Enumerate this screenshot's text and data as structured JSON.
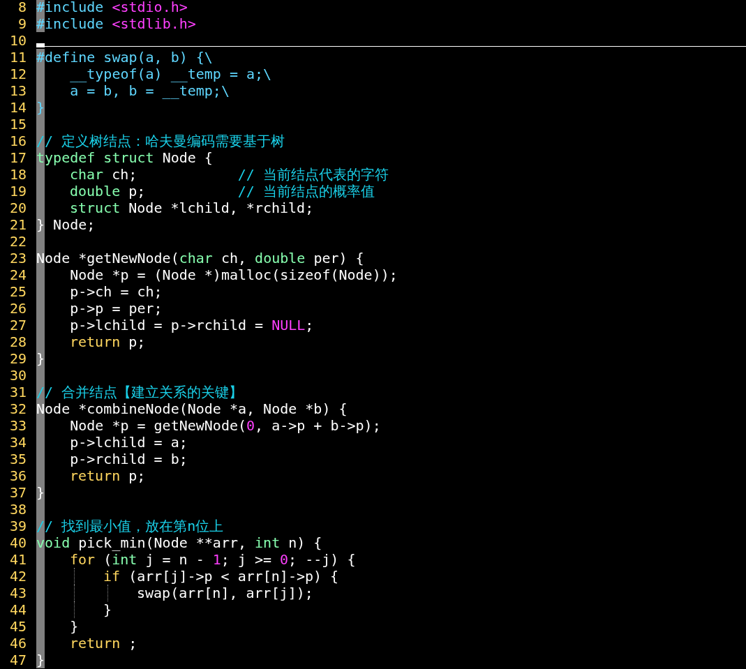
{
  "editor": {
    "lines": [
      {
        "number": "8",
        "current": false,
        "tokens": [
          {
            "text": "#include",
            "kind": "preproc"
          },
          {
            "text": " <stdio.h>",
            "kind": "string"
          }
        ]
      },
      {
        "number": "9",
        "current": false,
        "tokens": [
          {
            "text": "#include",
            "kind": "preproc"
          },
          {
            "text": " <stdlib.h>",
            "kind": "string"
          }
        ]
      },
      {
        "number": "10",
        "current": true
      },
      {
        "number": "11",
        "current": false,
        "tokens": [
          {
            "text": "#define swap(a, b) {\\",
            "kind": "preproc"
          }
        ]
      },
      {
        "number": "12",
        "current": false,
        "tokens": [
          {
            "text": "    __typeof(a) __temp = a;\\",
            "kind": "preproc"
          }
        ]
      },
      {
        "number": "13",
        "current": false,
        "tokens": [
          {
            "text": "    a = b, b = __temp;\\",
            "kind": "preproc"
          }
        ]
      },
      {
        "number": "14",
        "current": false,
        "tokens": [
          {
            "text": "}",
            "kind": "preproc"
          }
        ]
      },
      {
        "number": "15",
        "current": false
      },
      {
        "number": "16",
        "current": false,
        "tokens": [
          {
            "text": "// 定义树结点：哈夫曼编码需要基于树",
            "kind": "comment"
          }
        ]
      },
      {
        "number": "17",
        "current": false,
        "tokens": [
          {
            "text": "typedef struct",
            "kind": "type"
          },
          {
            "text": " Node {",
            "kind": "plain"
          }
        ]
      },
      {
        "number": "18",
        "current": false,
        "tokens": [
          {
            "kind": "indent"
          },
          {
            "text": "char",
            "kind": "type"
          },
          {
            "text": " ch;            ",
            "kind": "plain"
          },
          {
            "text": "// 当前结点代表的字符",
            "kind": "comment"
          }
        ]
      },
      {
        "number": "19",
        "current": false,
        "tokens": [
          {
            "kind": "indent"
          },
          {
            "text": "double",
            "kind": "type"
          },
          {
            "text": " p;           ",
            "kind": "plain"
          },
          {
            "text": "// 当前结点的概率值",
            "kind": "comment"
          }
        ]
      },
      {
        "number": "20",
        "current": false,
        "tokens": [
          {
            "kind": "indent"
          },
          {
            "text": "struct",
            "kind": "type"
          },
          {
            "text": " Node *lchild, *rchild;",
            "kind": "plain"
          }
        ]
      },
      {
        "number": "21",
        "current": false,
        "tokens": [
          {
            "text": "} Node;",
            "kind": "plain"
          }
        ]
      },
      {
        "number": "22",
        "current": false
      },
      {
        "number": "23",
        "current": false,
        "tokens": [
          {
            "text": "Node *getNewNode(",
            "kind": "plain"
          },
          {
            "text": "char",
            "kind": "type"
          },
          {
            "text": " ch, ",
            "kind": "plain"
          },
          {
            "text": "double",
            "kind": "type"
          },
          {
            "text": " per) {",
            "kind": "plain"
          }
        ]
      },
      {
        "number": "24",
        "current": false,
        "tokens": [
          {
            "text": "    Node *p = (Node *)malloc(sizeof(Node));",
            "kind": "plain"
          }
        ]
      },
      {
        "number": "25",
        "current": false,
        "tokens": [
          {
            "text": "    p->ch = ch;",
            "kind": "plain"
          }
        ]
      },
      {
        "number": "26",
        "current": false,
        "tokens": [
          {
            "text": "    p->p = per;",
            "kind": "plain"
          }
        ]
      },
      {
        "number": "27",
        "current": false,
        "tokens": [
          {
            "text": "    p->lchild = p->rchild = ",
            "kind": "plain"
          },
          {
            "text": "NULL",
            "kind": "constant"
          },
          {
            "text": ";",
            "kind": "plain"
          }
        ]
      },
      {
        "number": "28",
        "current": false,
        "tokens": [
          {
            "kind": "indent"
          },
          {
            "text": "return",
            "kind": "keyword"
          },
          {
            "text": " p;",
            "kind": "plain"
          }
        ]
      },
      {
        "number": "29",
        "current": false,
        "tokens": [
          {
            "text": "}",
            "kind": "plain"
          }
        ]
      },
      {
        "number": "30",
        "current": false
      },
      {
        "number": "31",
        "current": false,
        "tokens": [
          {
            "text": "// 合并结点【建立关系的关键】",
            "kind": "comment"
          }
        ]
      },
      {
        "number": "32",
        "current": false,
        "tokens": [
          {
            "text": "Node *combineNode(Node *a, Node *b) {",
            "kind": "plain"
          }
        ]
      },
      {
        "number": "33",
        "current": false,
        "tokens": [
          {
            "text": "    Node *p = getNewNode(",
            "kind": "plain"
          },
          {
            "text": "0",
            "kind": "constant"
          },
          {
            "text": ", a->p + b->p);",
            "kind": "plain"
          }
        ]
      },
      {
        "number": "34",
        "current": false,
        "tokens": [
          {
            "text": "    p->lchild = a;",
            "kind": "plain"
          }
        ]
      },
      {
        "number": "35",
        "current": false,
        "tokens": [
          {
            "text": "    p->rchild = b;",
            "kind": "plain"
          }
        ]
      },
      {
        "number": "36",
        "current": false,
        "tokens": [
          {
            "kind": "indent"
          },
          {
            "text": "return",
            "kind": "keyword"
          },
          {
            "text": " p;",
            "kind": "plain"
          }
        ]
      },
      {
        "number": "37",
        "current": false,
        "tokens": [
          {
            "text": "}",
            "kind": "plain"
          }
        ]
      },
      {
        "number": "38",
        "current": false
      },
      {
        "number": "39",
        "current": false,
        "tokens": [
          {
            "text": "// 找到最小值，放在第n位上",
            "kind": "comment"
          }
        ]
      },
      {
        "number": "40",
        "current": false,
        "tokens": [
          {
            "text": "void",
            "kind": "type"
          },
          {
            "text": " pick_min(Node **arr, ",
            "kind": "plain"
          },
          {
            "text": "int",
            "kind": "type"
          },
          {
            "text": " n) {",
            "kind": "plain"
          }
        ]
      },
      {
        "number": "41",
        "current": false,
        "tokens": [
          {
            "kind": "indent"
          },
          {
            "text": "for",
            "kind": "keyword"
          },
          {
            "text": " (",
            "kind": "plain"
          },
          {
            "text": "int",
            "kind": "type"
          },
          {
            "text": " j = n - ",
            "kind": "plain"
          },
          {
            "text": "1",
            "kind": "constant"
          },
          {
            "text": "; j >= ",
            "kind": "plain"
          },
          {
            "text": "0",
            "kind": "constant"
          },
          {
            "text": "; --j) {",
            "kind": "plain"
          }
        ]
      },
      {
        "number": "42",
        "current": false,
        "tokens": [
          {
            "kind": "indent"
          },
          {
            "kind": "guide"
          },
          {
            "text": "if",
            "kind": "keyword"
          },
          {
            "text": " (arr[j]->p < arr[n]->p) {",
            "kind": "plain"
          }
        ]
      },
      {
        "number": "43",
        "current": false,
        "tokens": [
          {
            "kind": "indent"
          },
          {
            "kind": "guide"
          },
          {
            "kind": "guide"
          },
          {
            "text": "swap(arr[n], arr[j]);",
            "kind": "plain"
          }
        ]
      },
      {
        "number": "44",
        "current": false,
        "tokens": [
          {
            "kind": "indent"
          },
          {
            "kind": "guide"
          },
          {
            "text": "}",
            "kind": "plain"
          }
        ]
      },
      {
        "number": "45",
        "current": false,
        "tokens": [
          {
            "text": "    }",
            "kind": "plain"
          }
        ]
      },
      {
        "number": "46",
        "current": false,
        "tokens": [
          {
            "kind": "indent"
          },
          {
            "text": "return",
            "kind": "keyword"
          },
          {
            "text": " ;",
            "kind": "plain"
          }
        ]
      },
      {
        "number": "47",
        "current": false,
        "tokens": [
          {
            "text": "}",
            "kind": "plain"
          }
        ]
      }
    ]
  }
}
